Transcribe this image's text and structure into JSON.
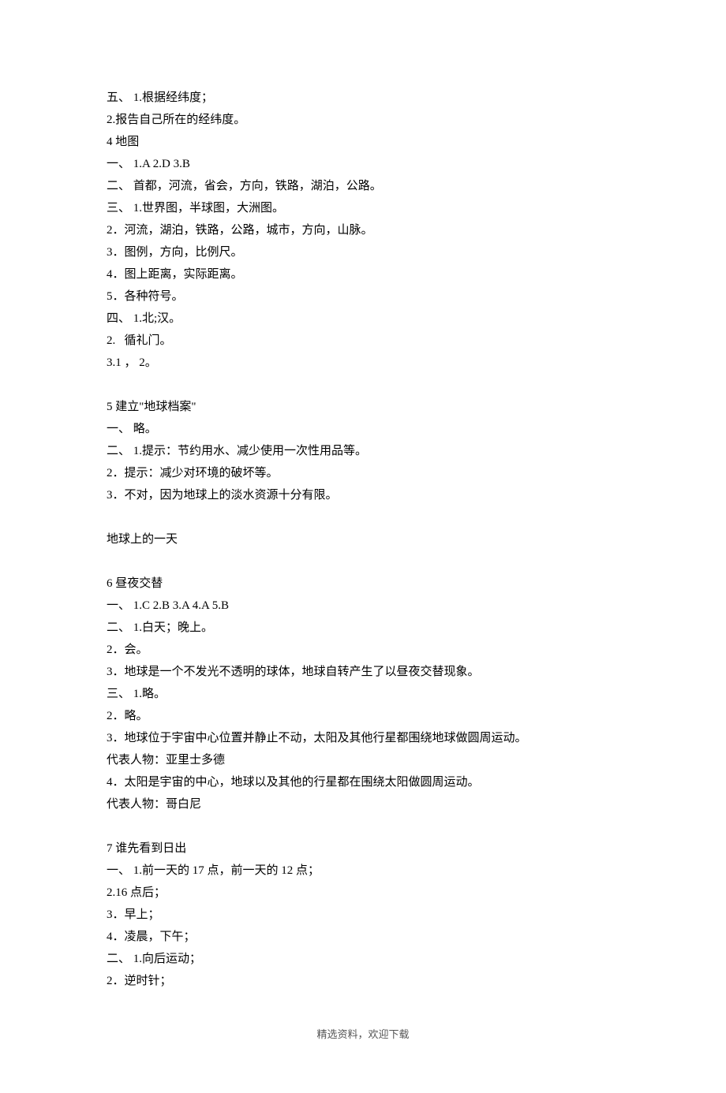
{
  "lines": [
    "五、 1.根据经纬度；",
    "2.报告自己所在的经纬度。",
    "4 地图",
    "一、 1.A 2.D 3.B",
    "二、 首都，河流，省会，方向，铁路，湖泊，公路。",
    "三、 1.世界图，半球图，大洲图。",
    "2．河流，湖泊，铁路，公路，城市，方向，山脉。",
    "3．图例，方向，比例尺。",
    "4．图上距离，实际距离。",
    "5．各种符号。",
    "四、 1.北;汉。",
    "2.   循礼门。",
    "3.1 ， 2。",
    "",
    "5 建立\"地球档案\"",
    "一、 略。",
    "二、 1.提示：节约用水、减少使用一次性用品等。",
    "2．提示：减少对环境的破坏等。",
    "3．不对，因为地球上的淡水资源十分有限。",
    "",
    "地球上的一天",
    "",
    "6 昼夜交替",
    "一、 1.C 2.B 3.A 4.A 5.B",
    "二、 1.白天；晚上。",
    "2．会。",
    "3．地球是一个不发光不透明的球体，地球自转产生了以昼夜交替现象。",
    "三、 1.略。",
    "2．略。",
    "3．地球位于宇宙中心位置并静止不动，太阳及其他行星都围绕地球做圆周运动。",
    "代表人物：亚里士多德",
    "4．太阳是宇宙的中心，地球以及其他的行星都在围绕太阳做圆周运动。",
    "代表人物：哥白尼",
    "",
    "7 谁先看到日出",
    "一、 1.前一天的 17 点，前一天的 12 点；",
    "2.16 点后；",
    "3．早上；",
    "4．凌晨，下午；",
    "二、 1.向后运动；",
    "2．逆时针；"
  ],
  "footer": "精选资料，欢迎下载"
}
